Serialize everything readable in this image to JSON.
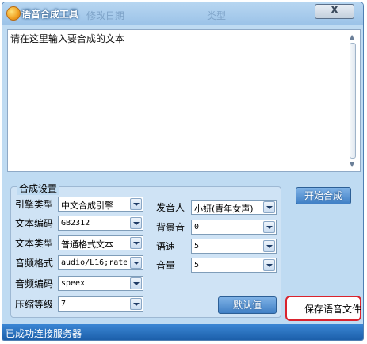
{
  "window": {
    "title": "语音合成工具",
    "ghost_columns": [
      "修改日期",
      "类型"
    ],
    "close_label": "X"
  },
  "textarea": {
    "placeholder": "请在这里输入要合成的文本"
  },
  "settings": {
    "group_title": "合成设置",
    "left": [
      {
        "label": "引擎类型",
        "value": "中文合成引擎"
      },
      {
        "label": "文本编码",
        "value": "GB2312"
      },
      {
        "label": "文本类型",
        "value": "普通格式文本"
      },
      {
        "label": "音频格式",
        "value": "audio/L16;rate="
      },
      {
        "label": "音频编码",
        "value": "speex"
      },
      {
        "label": "压缩等级",
        "value": "7"
      }
    ],
    "right": [
      {
        "label": "发音人",
        "value": "小妍(青年女声)"
      },
      {
        "label": "背景音",
        "value": "0"
      },
      {
        "label": "语速",
        "value": "5"
      },
      {
        "label": "音量",
        "value": "5"
      }
    ],
    "default_button": "默认值"
  },
  "actions": {
    "start_button": "开始合成",
    "save_checkbox_label": "保存语音文件",
    "save_checked": false
  },
  "status": {
    "text": "已成功连接服务器"
  },
  "colors": {
    "highlight_border": "#d9232e",
    "status_bar": "#1c5faa",
    "button": "#3f7fc5"
  }
}
